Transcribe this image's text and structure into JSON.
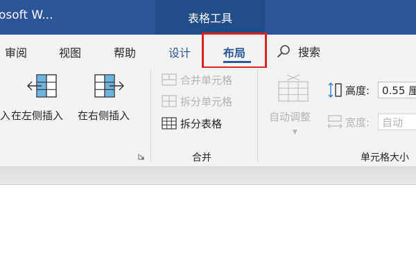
{
  "titlebar": {
    "app_title": "osoft W...",
    "context_tab": "表格工具"
  },
  "tabs": {
    "review": "审阅",
    "view": "视图",
    "help": "帮助",
    "design": "设计",
    "layout": "布局",
    "search": "搜索"
  },
  "rows_cols": {
    "insert_above_partial": "入",
    "insert_left": "在左侧插入",
    "insert_right": "在右侧插入"
  },
  "merge": {
    "merge_cells": "合并单元格",
    "split_cells": "拆分单元格",
    "split_table": "拆分表格",
    "group_label": "合并"
  },
  "cell_size": {
    "autofit": "自动调整",
    "height_label": "高度:",
    "height_value": "0.55 厘",
    "width_label": "宽度:",
    "width_value": "自动",
    "group_label": "单元格大小"
  },
  "colors": {
    "accent": "#2b579a",
    "highlight": "#e02020",
    "disabled": "#b3b3b3"
  }
}
